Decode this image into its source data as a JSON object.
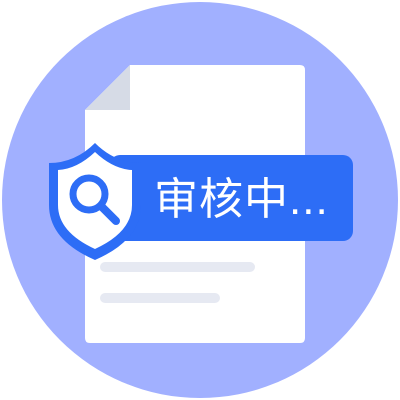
{
  "badge": {
    "status_label": "审核中..."
  },
  "colors": {
    "circle_background": "#a1b0ff",
    "document": "#ffffff",
    "document_fold": "#d6dbe6",
    "text_lines": "#e6e9f2",
    "accent_blue": "#2d6df6",
    "shield_inner": "#ffffff"
  },
  "icons": {
    "document": "document-icon",
    "shield": "shield-icon",
    "search": "search-icon"
  }
}
